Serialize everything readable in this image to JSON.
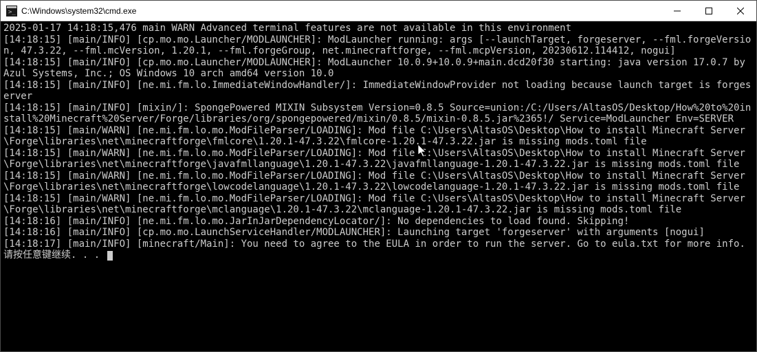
{
  "window": {
    "title": "C:\\Windows\\system32\\cmd.exe"
  },
  "terminal": {
    "lines": [
      "2025-01-17 14:18:15,476 main WARN Advanced terminal features are not available in this environment",
      "[14:18:15] [main/INFO] [cp.mo.mo.Launcher/MODLAUNCHER]: ModLauncher running: args [--launchTarget, forgeserver, --fml.forgeVersion, 47.3.22, --fml.mcVersion, 1.20.1, --fml.forgeGroup, net.minecraftforge, --fml.mcpVersion, 20230612.114412, nogui]",
      "[14:18:15] [main/INFO] [cp.mo.mo.Launcher/MODLAUNCHER]: ModLauncher 10.0.9+10.0.9+main.dcd20f30 starting: java version 17.0.7 by Azul Systems, Inc.; OS Windows 10 arch amd64 version 10.0",
      "[14:18:15] [main/INFO] [ne.mi.fm.lo.ImmediateWindowHandler/]: ImmediateWindowProvider not loading because launch target is forgeserver",
      "[14:18:15] [main/INFO] [mixin/]: SpongePowered MIXIN Subsystem Version=0.8.5 Source=union:/C:/Users/AltasOS/Desktop/How%20to%20install%20Minecraft%20Server/Forge/libraries/org/spongepowered/mixin/0.8.5/mixin-0.8.5.jar%2365!/ Service=ModLauncher Env=SERVER",
      "[14:18:15] [main/WARN] [ne.mi.fm.lo.mo.ModFileParser/LOADING]: Mod file C:\\Users\\AltasOS\\Desktop\\How to install Minecraft Server\\Forge\\libraries\\net\\minecraftforge\\fmlcore\\1.20.1-47.3.22\\fmlcore-1.20.1-47.3.22.jar is missing mods.toml file",
      "[14:18:15] [main/WARN] [ne.mi.fm.lo.mo.ModFileParser/LOADING]: Mod file C:\\Users\\AltasOS\\Desktop\\How to install Minecraft Server\\Forge\\libraries\\net\\minecraftforge\\javafmllanguage\\1.20.1-47.3.22\\javafmllanguage-1.20.1-47.3.22.jar is missing mods.toml file",
      "[14:18:15] [main/WARN] [ne.mi.fm.lo.mo.ModFileParser/LOADING]: Mod file C:\\Users\\AltasOS\\Desktop\\How to install Minecraft Server\\Forge\\libraries\\net\\minecraftforge\\lowcodelanguage\\1.20.1-47.3.22\\lowcodelanguage-1.20.1-47.3.22.jar is missing mods.toml file",
      "[14:18:15] [main/WARN] [ne.mi.fm.lo.mo.ModFileParser/LOADING]: Mod file C:\\Users\\AltasOS\\Desktop\\How to install Minecraft Server\\Forge\\libraries\\net\\minecraftforge\\mclanguage\\1.20.1-47.3.22\\mclanguage-1.20.1-47.3.22.jar is missing mods.toml file",
      "[14:18:16] [main/INFO] [ne.mi.fm.lo.mo.JarInJarDependencyLocator/]: No dependencies to load found. Skipping!",
      "[14:18:16] [main/INFO] [cp.mo.mo.LaunchServiceHandler/MODLAUNCHER]: Launching target 'forgeserver' with arguments [nogui]",
      "[14:18:17] [main/INFO] [minecraft/Main]: You need to agree to the EULA in order to run the server. Go to eula.txt for more info."
    ],
    "prompt": "请按任意键继续. . . "
  }
}
